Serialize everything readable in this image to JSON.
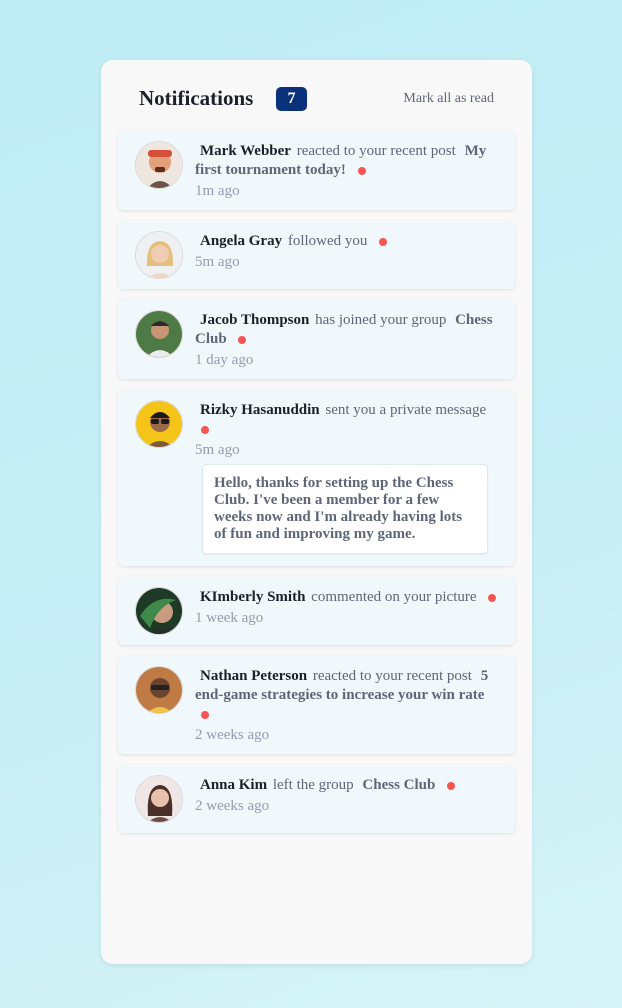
{
  "header": {
    "title": "Notifications",
    "unread_count": "7",
    "mark_all_label": "Mark all as read"
  },
  "notifications": [
    {
      "name": "Mark Webber",
      "action": "reacted to your recent post",
      "target": "My first tournament today!",
      "time": "1m ago",
      "unread": true,
      "avatar_color": "#d98f60",
      "message": ""
    },
    {
      "name": "Angela Gray",
      "action": "followed you",
      "target": "",
      "time": "5m ago",
      "unread": true,
      "avatar_color": "#e8c397",
      "message": ""
    },
    {
      "name": "Jacob Thompson",
      "action": "has joined your group",
      "target": "Chess Club",
      "time": "1 day ago",
      "unread": true,
      "avatar_color": "#4f7d4a",
      "message": ""
    },
    {
      "name": "Rizky Hasanuddin",
      "action": "sent you a private message",
      "target": "",
      "time": "5m ago",
      "unread": true,
      "avatar_color": "#f4c418",
      "message": "Hello, thanks for setting up the Chess Club. I've been a member for a few weeks now and I'm already having lots of fun and improving my game."
    },
    {
      "name": "KImberly Smith",
      "action": "commented on your picture",
      "target": "",
      "time": "1 week ago",
      "unread": true,
      "avatar_color": "#1f4a2d",
      "message": ""
    },
    {
      "name": "Nathan Peterson",
      "action": "reacted to your recent post",
      "target": "5 end-game strategies to increase your win rate",
      "time": "2 weeks ago",
      "unread": true,
      "avatar_color": "#c1773f",
      "message": ""
    },
    {
      "name": "Anna Kim",
      "action": "left the group",
      "target": "Chess Club",
      "time": "2 weeks ago",
      "unread": true,
      "avatar_color": "#e9d4cf",
      "message": ""
    }
  ]
}
